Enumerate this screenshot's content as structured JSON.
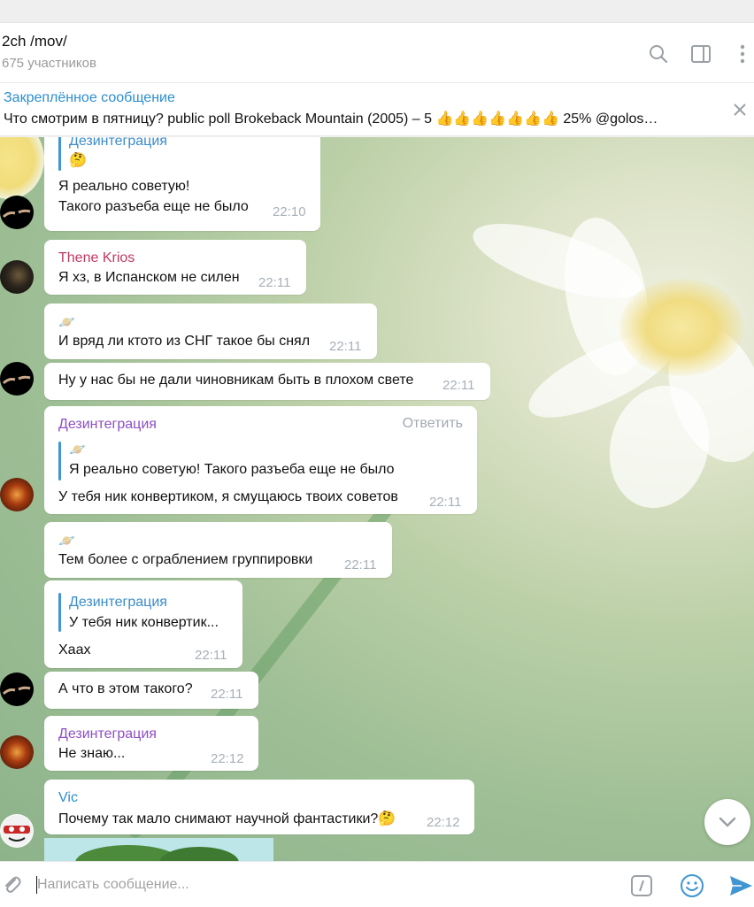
{
  "header": {
    "title": "2ch /mov/",
    "subtitle": "675 участников"
  },
  "pinned": {
    "title": "Закреплённое сообщение",
    "text": "Что смотрим в пятницу? public poll  Brokeback Mountain (2005) – 5 👍👍👍👍👍👍👍 25% @golos…"
  },
  "messages": [
    {
      "reply_name": "Дезинтеграция",
      "reply_text": "🤔",
      "line1": "Я реально советую!",
      "line2": "Такого разъеба еще не было",
      "time": "22:10"
    },
    {
      "sender": "Thene Krios",
      "sender_color": "#c0395f",
      "text": "Я хз, в Испанском не силен",
      "time": "22:11"
    },
    {
      "emoji": "🪐",
      "text": "И вряд ли ктото из СНГ такое бы снял",
      "time": "22:11"
    },
    {
      "text": "Ну у нас бы не дали чиновникам быть в плохом свете",
      "time": "22:11"
    },
    {
      "sender": "Дезинтеграция",
      "sender_color": "#8e4fc4",
      "action": "Ответить",
      "reply_emoji": "🪐",
      "reply_text": "Я реально советую! Такого разъеба еще не было",
      "text": "У тебя ник конвертиком, я смущаюсь твоих советов",
      "time": "22:11"
    },
    {
      "emoji": "🪐",
      "text": "Тем более с ограблением группировки",
      "time": "22:11"
    },
    {
      "reply_name": "Дезинтеграция",
      "reply_text": "У тебя ник конвертик...",
      "text": "Хаах",
      "time": "22:11"
    },
    {
      "text": "А что в этом такого?",
      "time": "22:11"
    },
    {
      "sender": "Дезинтеграция",
      "sender_color": "#8e4fc4",
      "text": "Не знаю...",
      "time": "22:12"
    },
    {
      "sender": "Vic",
      "sender_color": "#2d8ed0",
      "text": "Почему так мало снимают научной фантастики?🤔",
      "time": "22:12"
    }
  ],
  "composer": {
    "placeholder": "Написать сообщение..."
  },
  "colors": {
    "accent": "#2d8ed0",
    "reply_bar": "#3f96d2",
    "time": "#a8b0b8"
  },
  "icons": [
    "search-icon",
    "sidebar-toggle-icon",
    "more-vertical-icon",
    "close-icon",
    "chevron-down-icon",
    "attach-icon",
    "command-icon",
    "emoji-icon",
    "send-icon"
  ]
}
